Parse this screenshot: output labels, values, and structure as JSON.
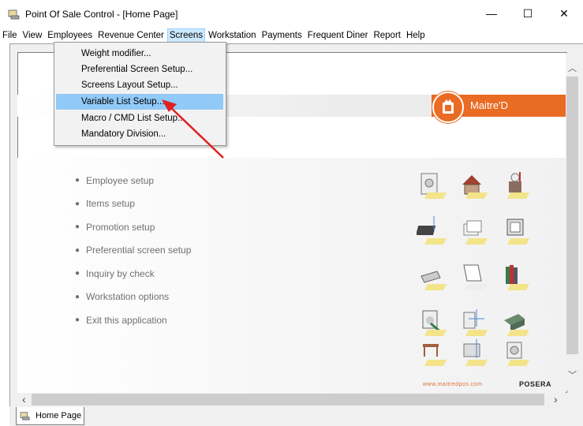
{
  "window": {
    "title": "Point Of Sale Control - [Home Page]",
    "minimize": "—",
    "maximize": "☐",
    "close": "✕"
  },
  "menu": [
    "File",
    "View",
    "Employees",
    "Revenue Center",
    "Screens",
    "Workstation",
    "Payments",
    "Frequent Diner",
    "Report",
    "Help"
  ],
  "active_menu": "Screens",
  "screens_menu": {
    "items": [
      "Weight modifier...",
      "Preferential Screen Setup...",
      "Screens Layout Setup...",
      "Variable List Setup...",
      "Macro / CMD List Setup...",
      "Mandatory Division..."
    ],
    "highlighted": "Variable List Setup..."
  },
  "home": {
    "logo_text": "Maitre'D",
    "links": [
      "Employee setup",
      "Items setup",
      "Promotion setup",
      "Preferential screen setup",
      "Inquiry by check",
      "Workstation options",
      "Exit this application"
    ],
    "footer_url": "www.maitredpos.com",
    "footer_brand": "POSERA",
    "accent_color": "#ea6b23"
  },
  "tabs": [
    "Home Page"
  ]
}
